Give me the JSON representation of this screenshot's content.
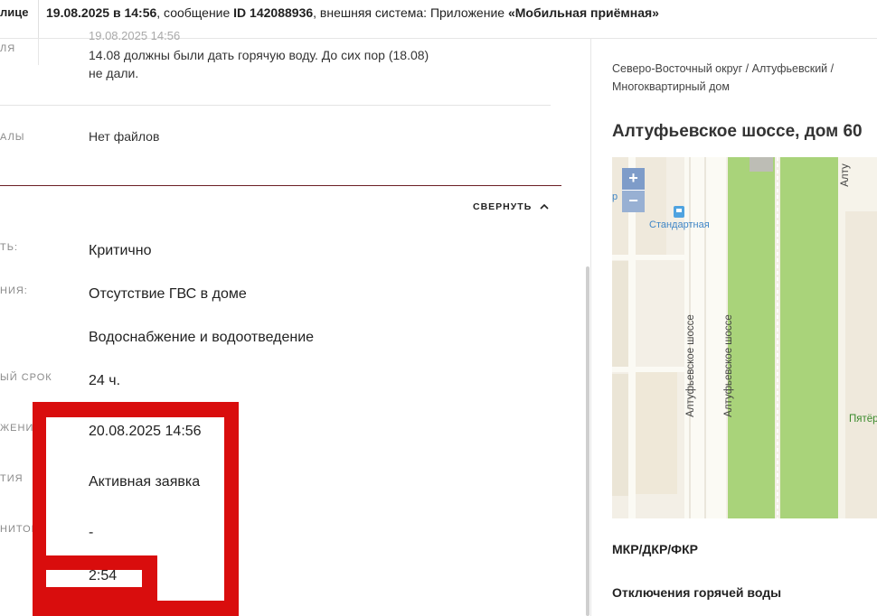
{
  "top_bar": {
    "left_cut": "лице",
    "date_time": "19.08.2025 в 14:56",
    "text_message": ", сообщение ",
    "message_id": "ID 142088936",
    "text_system": ", внешняя система: Приложение ",
    "system_name": "«Мобильная приёмная»"
  },
  "message": {
    "label_cut": "ля",
    "timestamp_cut": "19.08.2025 14:56",
    "text_line1": "14.08 должны были дать горячую воду. До сих пор (18.08)",
    "text_line2": "не дали."
  },
  "files": {
    "label_cut": "алы",
    "value": "Нет файлов"
  },
  "collapse_button": "СВЕРНУТЬ",
  "details": [
    {
      "label": "ть:",
      "value": "Критично"
    },
    {
      "label": "ния:",
      "value": "Отсутствие ГВС в доме"
    },
    {
      "label": "",
      "value": "Водоснабжение и водоотведение"
    },
    {
      "label": "ый срок",
      "value": "24 ч."
    },
    {
      "label": "жения на",
      "value": "20.08.2025 14:56"
    },
    {
      "label": "тия",
      "value": "Активная заявка"
    },
    {
      "label": "нитор",
      "value": "-"
    },
    {
      "label": "",
      "value": "2:54"
    }
  ],
  "right_panel": {
    "breadcrumb_line1": "Северо-Восточный округ / Алтуфьевский /",
    "breadcrumb_line2": "Многоквартирный дом",
    "address": "Алтуфьевское шоссе, дом 60",
    "map": {
      "zoom_in": "+",
      "zoom_out": "−",
      "stop_label": "Стандартная",
      "street_label_1": "Алтуфьевское шоссе",
      "street_label_2": "Алтуфьевское шоссе",
      "street_label_top": "Алту",
      "shop_label": "Пятёр",
      "left_edge_label": "р"
    },
    "section1": "МКР/ДКР/ФКР",
    "section2": "Отключения горячей воды"
  },
  "colors": {
    "redaction": "#d90d0d",
    "divider_dark": "#6b1f24",
    "map_green": "#a9d37a",
    "map_road": "#fbfaf4",
    "zoom_button": "#7e9cc9"
  }
}
